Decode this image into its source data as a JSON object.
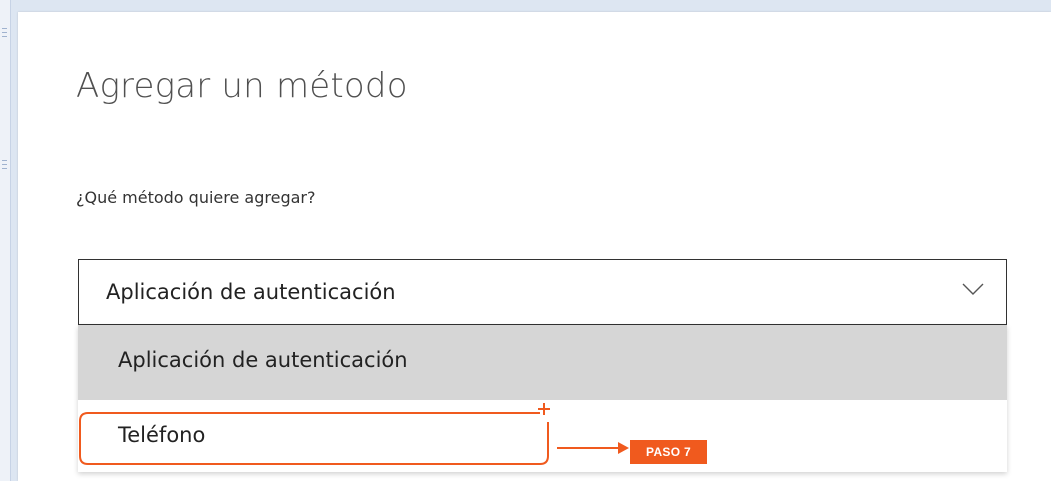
{
  "dialog": {
    "title": "Agregar un método",
    "question": "¿Qué método quiere agregar?"
  },
  "select": {
    "value": "Aplicación de autenticación",
    "options": [
      {
        "label": "Aplicación de autenticación",
        "selected": true
      },
      {
        "label": "Teléfono",
        "selected": false
      }
    ]
  },
  "annotation": {
    "step_label": "PASO 7",
    "color": "#f05a1e"
  },
  "colors": {
    "selected_option_bg": "#d6d6d6",
    "select_border": "#323232"
  }
}
